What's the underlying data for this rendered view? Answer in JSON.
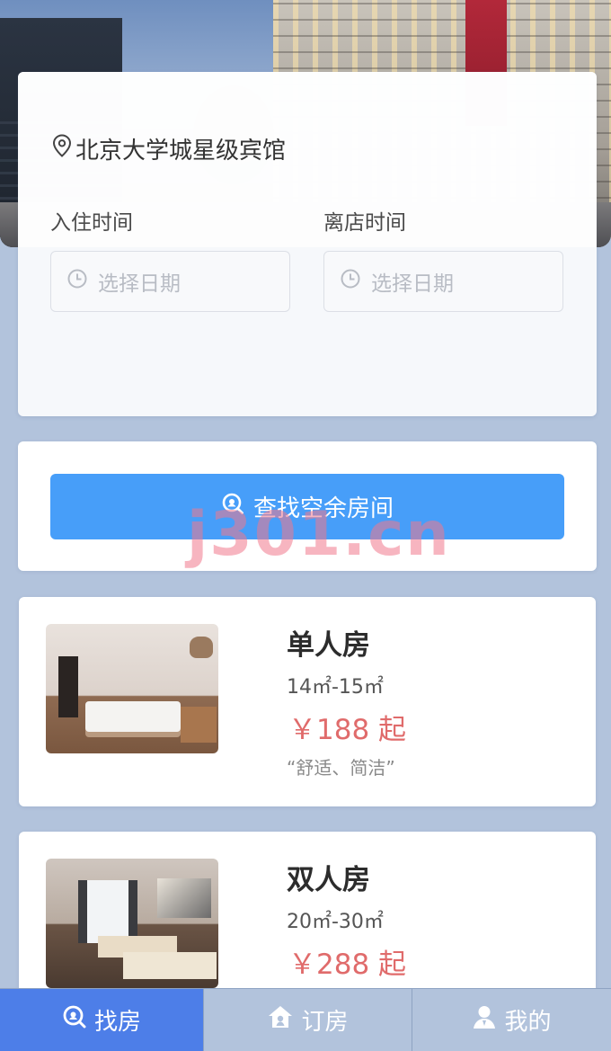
{
  "hotel": {
    "name": "北京大学城星级宾馆"
  },
  "search": {
    "checkin_label": "入住时间",
    "checkout_label": "离店时间",
    "date_placeholder": "选择日期",
    "button_label": "查找空余房间"
  },
  "watermark": "j301.cn",
  "rooms": [
    {
      "name": "单人房",
      "size": "14㎡-15㎡",
      "price": "￥188 起",
      "desc": "“舒适、简洁”"
    },
    {
      "name": "双人房",
      "size": "20㎡-30㎡",
      "price": "￥288 起"
    }
  ],
  "tabs": [
    {
      "label": "找房",
      "icon": "search-icon"
    },
    {
      "label": "订房",
      "icon": "home-icon"
    },
    {
      "label": "我的",
      "icon": "user-icon"
    }
  ],
  "colors": {
    "accent": "#479ef9",
    "tab_active": "#4d7ee8",
    "price": "#e06b6b",
    "background": "#b2c3dc"
  }
}
